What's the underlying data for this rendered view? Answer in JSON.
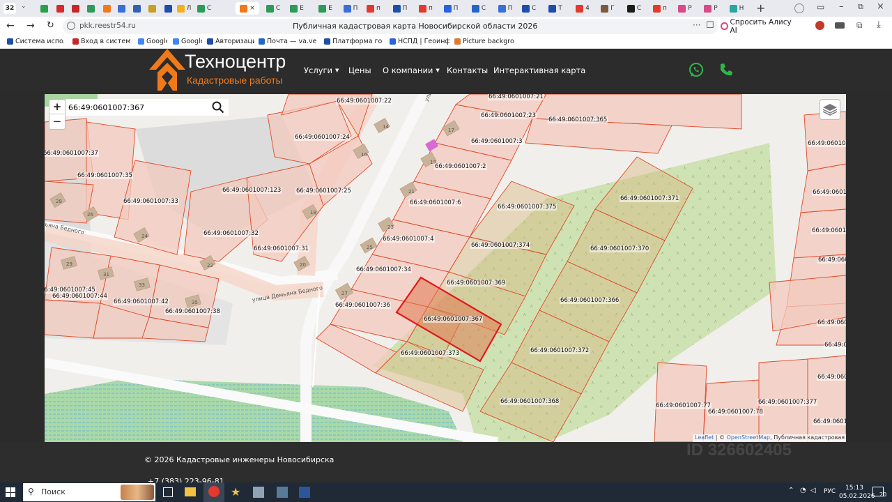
{
  "browser": {
    "tab_counter": "32",
    "tabs": [
      {
        "icon": "yandex-games-icon",
        "label": "",
        "color": "#2aa04a"
      },
      {
        "icon": "gosuslugi-icon",
        "label": "",
        "color": "#d22c2c"
      },
      {
        "icon": "gosuslugi-icon",
        "label": "",
        "color": "#c62828"
      },
      {
        "icon": "rosreestr-icon",
        "label": "",
        "color": "#2e9a5a"
      },
      {
        "icon": "house-icon",
        "label": "",
        "color": "#f07a1a"
      },
      {
        "icon": "globe-icon",
        "label": "",
        "color": "#3b6fd6"
      },
      {
        "icon": "shield-icon",
        "label": "",
        "color": "#2f63b0"
      },
      {
        "icon": "crest-icon",
        "label": "",
        "color": "#c8a020"
      },
      {
        "icon": "flag-icon",
        "label": "",
        "color": "#1e4ea8"
      },
      {
        "icon": "yandex-disk-icon",
        "label": "Л",
        "color": "#f3b21b"
      },
      {
        "icon": "rosreestr-icon",
        "label": "С",
        "color": "#2e9a5a"
      },
      {
        "icon": "house-icon",
        "label": "",
        "color": "#f07a1a"
      },
      {
        "icon": "rosreestr-icon",
        "label": "С",
        "color": "#2e9a5a"
      },
      {
        "icon": "rosreestr-icon",
        "label": "Е",
        "color": "#2e9a5a"
      },
      {
        "icon": "rosreestr-icon",
        "label": "Е",
        "color": "#2e9a5a"
      },
      {
        "icon": "globe-icon",
        "label": "П",
        "color": "#3b6fd6"
      },
      {
        "icon": "yandex-icon",
        "label": "п",
        "color": "#e23b2e"
      },
      {
        "icon": "flag-icon",
        "label": "П",
        "color": "#1e4ea8"
      },
      {
        "icon": "yandex-icon",
        "label": "п",
        "color": "#e23b2e"
      },
      {
        "icon": "s-icon",
        "label": "П",
        "color": "#2962d9"
      },
      {
        "icon": "mail-icon",
        "label": "С",
        "color": "#2466c8"
      },
      {
        "icon": "globe-icon",
        "label": "П",
        "color": "#3b6fd6"
      },
      {
        "icon": "crest-icon",
        "label": "С",
        "color": "#1e4ea8"
      },
      {
        "icon": "crest-icon",
        "label": "Т",
        "color": "#1e4ea8"
      },
      {
        "icon": "yandex-icon",
        "label": "4",
        "color": "#e23b2e"
      },
      {
        "icon": "avatar-icon",
        "label": "Г",
        "color": "#7a5a3a"
      },
      {
        "icon": "cian-icon",
        "label": "С",
        "color": "#1b1b1b"
      },
      {
        "icon": "yandex-icon",
        "label": "п",
        "color": "#e23b2e"
      },
      {
        "icon": "grid-icon",
        "label": "Р",
        "color": "#d84a8a"
      },
      {
        "icon": "grid-icon",
        "label": "Р",
        "color": "#d84a8a"
      },
      {
        "icon": "globe-icon",
        "label": "Н",
        "color": "#2aa6a0"
      }
    ],
    "active_tab_close": "×",
    "address": "pkk.reestr54.ru",
    "page_title": "Публичная кадастровая карта Новосибирской области 2026",
    "alice_button": "Спросить Алису AI",
    "bookmarks": [
      {
        "label": "Система исполне",
        "color": "#1e4ea8"
      },
      {
        "label": "Вход в систему эл",
        "color": "#c62828"
      },
      {
        "label": "Google",
        "color": "#4285f4"
      },
      {
        "label": "Google",
        "color": "#4285f4"
      },
      {
        "label": "Авторизация",
        "color": "#1e4ea8"
      },
      {
        "label": "Почта — va.verest",
        "color": "#2466c8"
      },
      {
        "label": "Платформа госуд",
        "color": "#1e4ea8"
      },
      {
        "label": "НСПД | Геоинфор",
        "color": "#2962d9"
      },
      {
        "label": "Picture background",
        "color": "#e07a2a"
      }
    ]
  },
  "site": {
    "logo_title": "Техноцентр",
    "logo_subtitle": "Кадастровые работы",
    "nav": [
      {
        "label": "Услуги",
        "dropdown": true
      },
      {
        "label": "Цены",
        "dropdown": false
      },
      {
        "label": "О компании",
        "dropdown": true
      },
      {
        "label": "Контакты",
        "dropdown": false
      },
      {
        "label": "Интерактивная карта",
        "dropdown": false
      }
    ],
    "accent_color": "#2fb64a",
    "orange_color": "#f07a1a"
  },
  "map": {
    "search_value": "66:49:0601007:367",
    "zoom_in": "+",
    "zoom_out": "−",
    "attribution": {
      "leaflet": "Leaflet",
      "sep": " | © ",
      "osm": "OpenStreetMap",
      "rest": ", Публичная кадастровая карта"
    },
    "streets": {
      "top": "улица",
      "bottom": "улица Демьяна Бедного",
      "left": "ьяна Бедного"
    },
    "house_numbers": [
      "17",
      "19",
      "21",
      "23",
      "25",
      "27",
      "14",
      "16",
      "18",
      "20",
      "22",
      "24",
      "26",
      "28",
      "29",
      "31",
      "33",
      "35"
    ],
    "selected_parcel": "66:49:0601007:367",
    "parcels": [
      "66:49:0601007:22",
      "66:49:0601007:21",
      "66:49:0601007:23",
      "66:49:0601007:365",
      "66:49:0601007:3",
      "66:49:0601007:24",
      "66:49:0601007:2",
      "66:49:0601007:37",
      "66:49:0601007:35",
      "66:49:0601007:123",
      "66:49:0601007:25",
      "66:49:0601007:33",
      "66:49:0601007:6",
      "66:49:0601007:375",
      "66:49:0601007:371",
      "66:49:0601007:32",
      "66:49:0601007:4",
      "66:49:0601007:374",
      "66:49:0601007:370",
      "66:49:0601007:31",
      "66:49:0601007:34",
      "66:49:0601007:369",
      "66:49:0601007:45",
      "66:49:0601007:44",
      "66:49:0601007:42",
      "66:49:0601007:38",
      "66:49:0601007:36",
      "66:49:0601007:366",
      "66:49:0601007:367",
      "66:49:0601007:373",
      "66:49:0601007:372",
      "66:49:0601007:368",
      "66:49:0601007:77",
      "66:49:0601007:78",
      "66:49:0601007:377",
      "66:49:060100",
      "66:49:0601",
      "66:49:0601",
      "66:49:060",
      "66:49:060",
      "66:49:060",
      "66:49:060",
      "66:49:0601"
    ]
  },
  "footer": {
    "copyright": "© 2026 Кадастровые инженеры Новосибирска",
    "phone": "+7 (383) 223-96-81",
    "watermark_id": "ID 326602405"
  },
  "taskbar": {
    "search": "Поиск",
    "lang": "РУС",
    "time": "15:13",
    "date": "05.02.2026",
    "notif": "20"
  }
}
